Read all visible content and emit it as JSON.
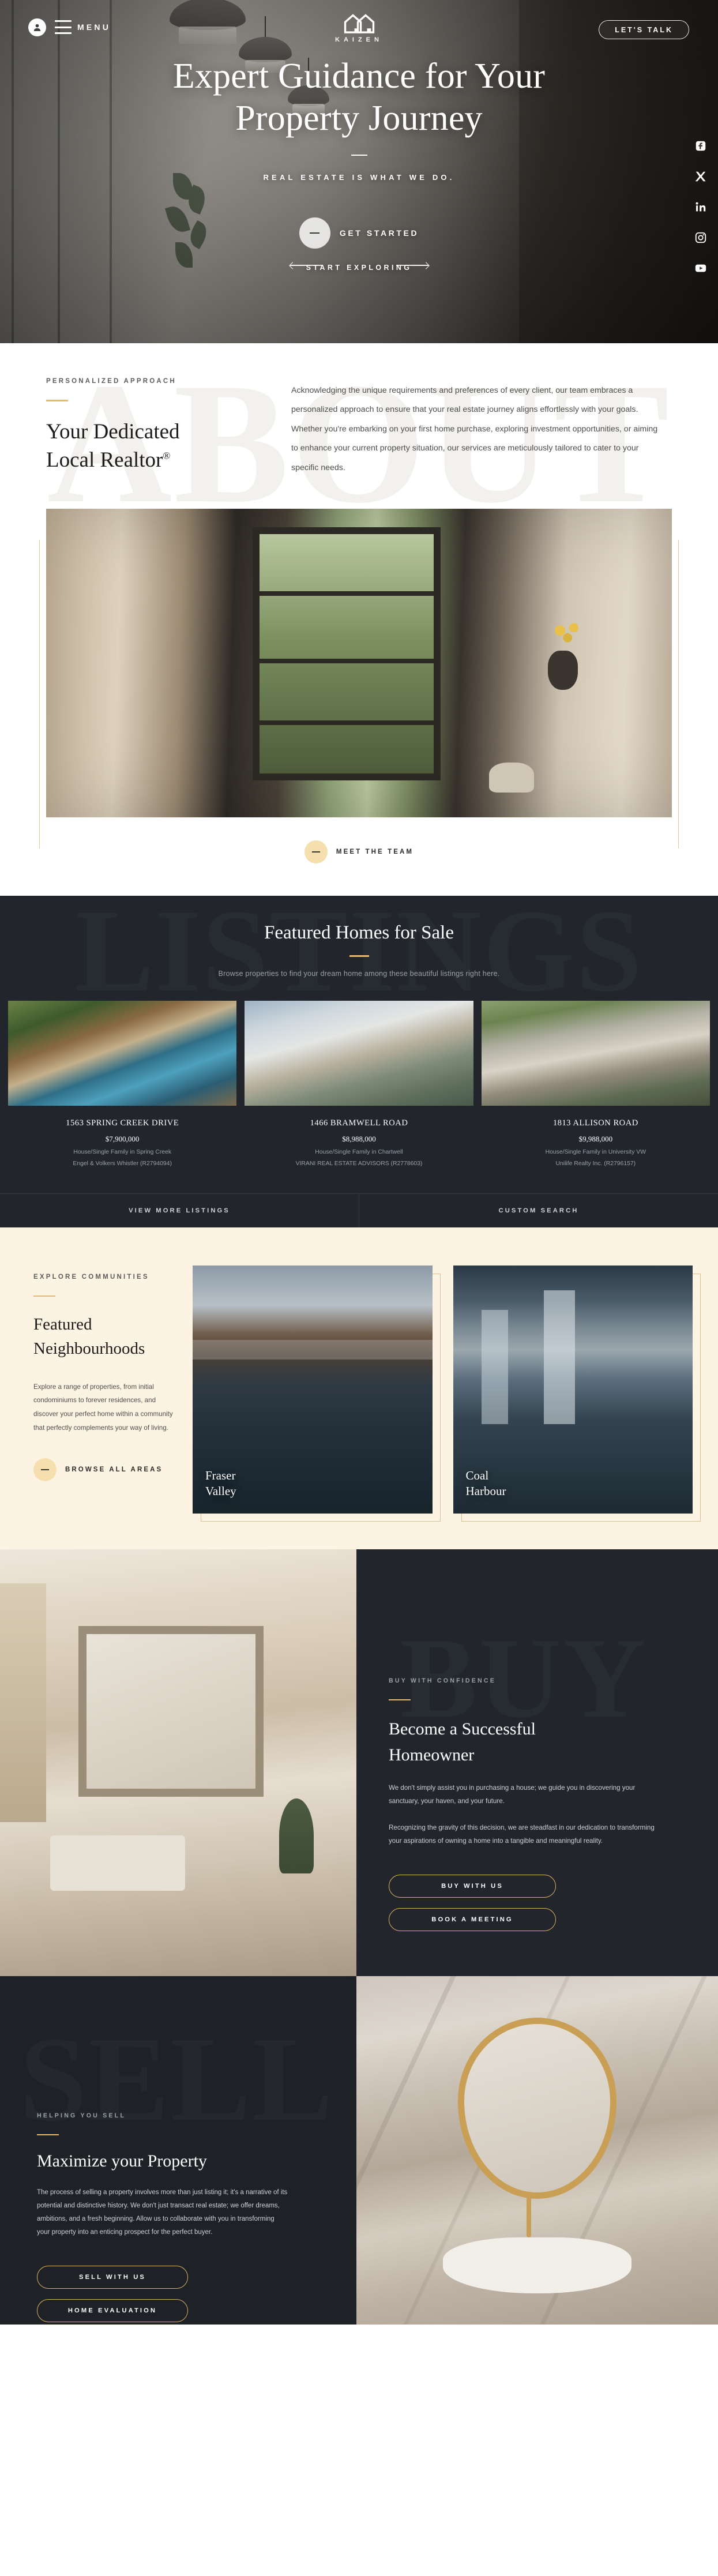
{
  "brand": {
    "name": "KAIZEN",
    "logo_icon": "double-house-icon",
    "accent": "#e8b96b",
    "dark": "#22262c",
    "cream": "#fdf3e3"
  },
  "nav": {
    "menu_label": "MENU",
    "account_icon": "user-avatar-icon",
    "hamburger_icon": "hamburger-menu-icon",
    "cta_label": "LET'S TALK"
  },
  "hero": {
    "title_line1": "Expert Guidance for Your",
    "title_line2": "Property Journey",
    "subtitle": "REAL ESTATE IS WHAT WE DO.",
    "get_started_label": "GET STARTED",
    "scroll_label": "START EXPLORING",
    "socials": [
      {
        "name": "facebook-icon",
        "label": "Facebook"
      },
      {
        "name": "x-twitter-icon",
        "label": "X"
      },
      {
        "name": "linkedin-icon",
        "label": "LinkedIn"
      },
      {
        "name": "instagram-icon",
        "label": "Instagram"
      },
      {
        "name": "youtube-icon",
        "label": "YouTube"
      }
    ]
  },
  "about": {
    "watermark": "ABOUT",
    "eyebrow": "PERSONALIZED APPROACH",
    "heading_line1": "Your Dedicated",
    "heading_line2": "Local Realtor",
    "heading_sup": "®",
    "body": "Acknowledging the unique requirements and preferences of every client, our team embraces a personalized approach to ensure that your real estate journey aligns effortlessly with your goals. Whether you're embarking on your first home purchase, exploring investment opportunities, or aiming to enhance your current property situation, our services are meticulously tailored to cater to your specific needs.",
    "cta_label": "MEET THE TEAM"
  },
  "listings": {
    "watermark": "LISTINGS",
    "heading": "Featured Homes for Sale",
    "subheading": "Browse properties to find your dream home among these beautiful listings right here.",
    "cards": [
      {
        "address": "1563 SPRING CREEK DRIVE",
        "price": "$7,900,000",
        "type": "House/Single Family in Spring Creek",
        "broker": "Engel & Volkers Whistler (R2794094)"
      },
      {
        "address": "1466 BRAMWELL ROAD",
        "price": "$8,988,000",
        "type": "House/Single Family in Chartwell",
        "broker": "VIRANI REAL ESTATE ADVISORS (R2778603)"
      },
      {
        "address": "1813 ALLISON ROAD",
        "price": "$9,988,000",
        "type": "House/Single Family in University VW",
        "broker": "Unilife Realty Inc. (R2796157)"
      }
    ],
    "actions": [
      {
        "label": "VIEW MORE LISTINGS"
      },
      {
        "label": "CUSTOM SEARCH"
      }
    ]
  },
  "neighbourhoods": {
    "eyebrow": "EXPLORE COMMUNITIES",
    "heading_line1": "Featured",
    "heading_line2": "Neighbourhoods",
    "body": "Explore a range of properties, from initial condominiums to forever residences, and discover your perfect home within a community that perfectly complements your way of living.",
    "cta_label": "BROWSE ALL AREAS",
    "items": [
      {
        "name_line1": "Fraser",
        "name_line2": "Valley"
      },
      {
        "name_line1": "Coal",
        "name_line2": "Harbour"
      }
    ]
  },
  "buy": {
    "watermark": "BUY",
    "eyebrow": "BUY WITH CONFIDENCE",
    "heading_line1": "Become a Successful",
    "heading_line2": "Homeowner",
    "paragraph1": "We don't simply assist you in purchasing a house; we guide you in discovering your sanctuary, your haven, and your future.",
    "paragraph2": "Recognizing the gravity of this decision, we are steadfast in our dedication to transforming your aspirations of owning a home into a tangible and meaningful reality.",
    "buttons": [
      {
        "label": "BUY WITH US"
      },
      {
        "label": "BOOK A MEETING"
      }
    ]
  },
  "sell": {
    "watermark": "SELL",
    "eyebrow": "HELPING YOU SELL",
    "heading": "Maximize your Property",
    "body": "The process of selling a property involves more than just listing it; it's a narrative of its potential and distinctive history. We don't just transact real estate; we offer dreams, ambitions, and a fresh beginning. Allow us to collaborate with you in transforming your property into an enticing prospect for the perfect buyer.",
    "buttons": [
      {
        "label": "SELL WITH US"
      },
      {
        "label": "HOME EVALUATION"
      }
    ]
  }
}
